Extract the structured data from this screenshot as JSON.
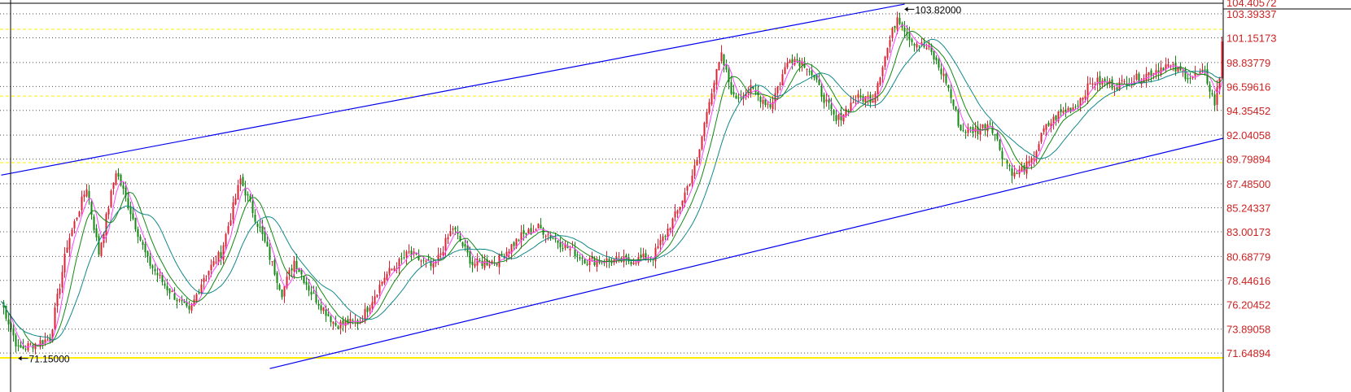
{
  "chart_data": {
    "type": "candlestick",
    "title": "",
    "xlabel": "",
    "ylabel": "",
    "ylim": [
      69.9,
      104.8
    ],
    "grid": true,
    "y_ticks": [
      "104.40572",
      "103.39337",
      "101.15173",
      "98.83779",
      "96.59616",
      "94.35452",
      "92.04058",
      "89.79894",
      "87.48500",
      "85.24337",
      "83.00173",
      "80.68779",
      "78.44616",
      "76.20452",
      "73.89058",
      "71.64894"
    ],
    "price_path": [
      [
        0,
        76.5
      ],
      [
        7,
        72.0
      ],
      [
        20,
        73.0
      ],
      [
        27,
        81.8
      ],
      [
        35,
        87.2
      ],
      [
        40,
        81.0
      ],
      [
        47,
        88.7
      ],
      [
        53,
        84.9
      ],
      [
        60,
        80.3
      ],
      [
        67,
        78.0
      ],
      [
        77,
        75.4
      ],
      [
        83,
        78.8
      ],
      [
        90,
        81.0
      ],
      [
        98,
        87.9
      ],
      [
        107,
        82.6
      ],
      [
        115,
        77.3
      ],
      [
        120,
        80.3
      ],
      [
        127,
        77.3
      ],
      [
        137,
        74.3
      ],
      [
        147,
        74.6
      ],
      [
        157,
        78.8
      ],
      [
        167,
        81.0
      ],
      [
        177,
        79.6
      ],
      [
        185,
        83.4
      ],
      [
        193,
        80.0
      ],
      [
        203,
        80.3
      ],
      [
        213,
        82.6
      ],
      [
        220,
        83.4
      ],
      [
        230,
        81.8
      ],
      [
        240,
        80.3
      ],
      [
        257,
        80.3
      ],
      [
        267,
        80.7
      ],
      [
        277,
        84.9
      ],
      [
        285,
        89.5
      ],
      [
        290,
        95.5
      ],
      [
        295,
        99.4
      ],
      [
        300,
        95.5
      ],
      [
        307,
        96.3
      ],
      [
        315,
        94.8
      ],
      [
        323,
        99.4
      ],
      [
        330,
        98.6
      ],
      [
        337,
        95.5
      ],
      [
        342,
        93.3
      ],
      [
        350,
        95.5
      ],
      [
        357,
        95.5
      ],
      [
        362,
        99.4
      ],
      [
        367,
        103.2
      ],
      [
        373,
        100.9
      ],
      [
        380,
        100.1
      ],
      [
        387,
        97.1
      ],
      [
        393,
        92.5
      ],
      [
        400,
        92.5
      ],
      [
        405,
        93.3
      ],
      [
        410,
        90.2
      ],
      [
        415,
        88.3
      ],
      [
        422,
        89.5
      ],
      [
        427,
        92.5
      ],
      [
        433,
        94.0
      ],
      [
        440,
        94.8
      ],
      [
        447,
        97.1
      ],
      [
        457,
        96.7
      ],
      [
        467,
        97.5
      ],
      [
        477,
        98.6
      ],
      [
        487,
        97.5
      ],
      [
        493,
        97.8
      ],
      [
        497,
        95.0
      ],
      [
        499,
        97.5
      ],
      [
        500,
        100.9
      ]
    ],
    "moving_averages": [
      {
        "name": "MA5",
        "period": 5,
        "color": "#ff44ff"
      },
      {
        "name": "MA10",
        "period": 10,
        "color": "#118811"
      },
      {
        "name": "MA20",
        "period": 20,
        "color": "#118888"
      }
    ],
    "trend_lines": [
      {
        "name": "upper-channel",
        "from": [
          0,
          88.3
        ],
        "to": [
          370,
          104.3
        ],
        "color": "#0000ee"
      },
      {
        "name": "lower-channel",
        "from": [
          110,
          70.2
        ],
        "to": [
          501,
          91.75
        ],
        "color": "#0000ee"
      }
    ],
    "horizontal_levels": [
      {
        "value": 101.95,
        "style": "dashed",
        "color": "#ffee00"
      },
      {
        "value": 95.7,
        "style": "dashed",
        "color": "#ffee00"
      },
      {
        "value": 89.47,
        "style": "dashed",
        "color": "#ffee00"
      },
      {
        "value": 71.2,
        "style": "solid",
        "color": "#ffee00"
      }
    ],
    "annotations": [
      {
        "label": "103.82000",
        "bar": 370,
        "value": 103.82,
        "type": "high"
      },
      {
        "label": "71.15000",
        "bar": 7,
        "value": 71.15,
        "type": "low"
      }
    ],
    "colors": {
      "up": "#dd2233",
      "down": "#118811",
      "axis_text": "#cc2222",
      "grid": "#555555"
    }
  }
}
